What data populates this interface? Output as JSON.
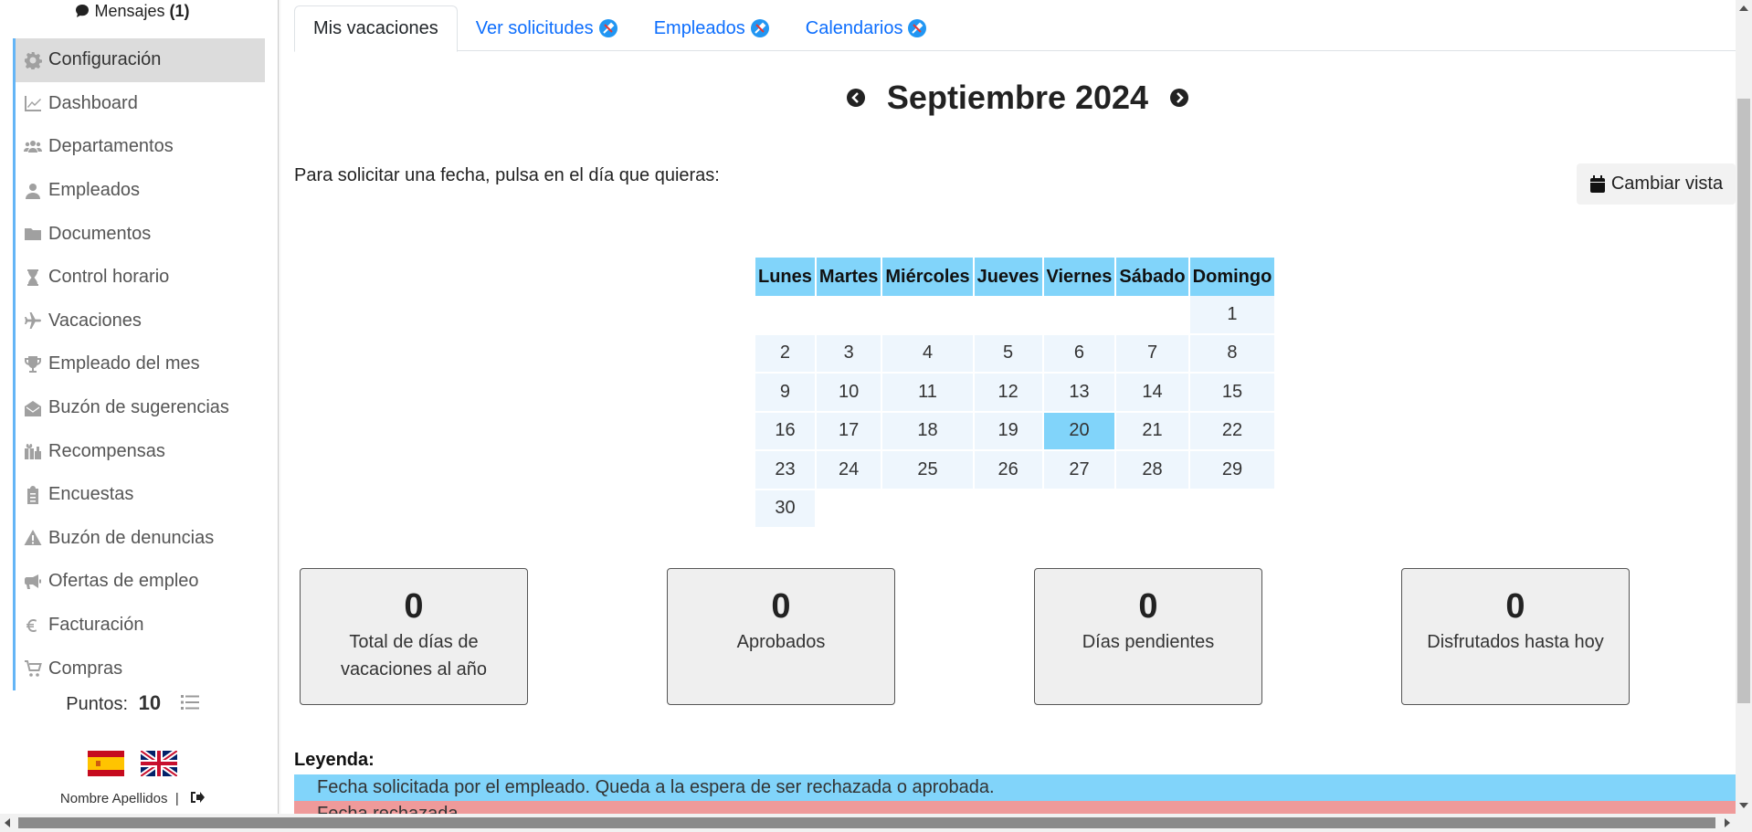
{
  "sidebar": {
    "messages_label": "Mensajes",
    "messages_count": "(1)",
    "items": [
      {
        "label": "Configuración",
        "icon": "gear-icon",
        "active": true
      },
      {
        "label": "Dashboard",
        "icon": "chart-line-icon"
      },
      {
        "label": "Departamentos",
        "icon": "users-icon"
      },
      {
        "label": "Empleados",
        "icon": "user-icon"
      },
      {
        "label": "Documentos",
        "icon": "folder-icon"
      },
      {
        "label": "Control horario",
        "icon": "hourglass-icon"
      },
      {
        "label": "Vacaciones",
        "icon": "plane-icon"
      },
      {
        "label": "Empleado del mes",
        "icon": "trophy-icon"
      },
      {
        "label": "Buzón de sugerencias",
        "icon": "envelope-open-icon"
      },
      {
        "label": "Recompensas",
        "icon": "gifts-icon"
      },
      {
        "label": "Encuestas",
        "icon": "clipboard-icon"
      },
      {
        "label": "Buzón de denuncias",
        "icon": "warning-icon"
      },
      {
        "label": "Ofertas de empleo",
        "icon": "megaphone-icon"
      },
      {
        "label": "Facturación",
        "icon": "euro-icon"
      },
      {
        "label": "Compras",
        "icon": "cart-icon"
      }
    ],
    "points_label": "Puntos:",
    "points_value": "10",
    "user_name": "Nombre Apellidos",
    "user_separator": "|"
  },
  "tabs": [
    {
      "label": "Mis vacaciones",
      "active": true
    },
    {
      "label": "Ver solicitudes",
      "tool_icon": true
    },
    {
      "label": "Empleados",
      "tool_icon": true
    },
    {
      "label": "Calendarios",
      "tool_icon": true
    }
  ],
  "calendar": {
    "month_title": "Septiembre 2024",
    "hint": "Para solicitar una fecha, pulsa en el día que quieras:",
    "change_view_label": "Cambiar vista",
    "weekdays": [
      "Lunes",
      "Martes",
      "Miércoles",
      "Jueves",
      "Viernes",
      "Sábado",
      "Domingo"
    ],
    "weeks": [
      [
        "",
        "",
        "",
        "",
        "",
        "",
        "1"
      ],
      [
        "2",
        "3",
        "4",
        "5",
        "6",
        "7",
        "8"
      ],
      [
        "9",
        "10",
        "11",
        "12",
        "13",
        "14",
        "15"
      ],
      [
        "16",
        "17",
        "18",
        "19",
        "20",
        "21",
        "22"
      ],
      [
        "23",
        "24",
        "25",
        "26",
        "27",
        "28",
        "29"
      ],
      [
        "30",
        "",
        "",
        "",
        "",
        "",
        ""
      ]
    ],
    "selected_day": "20"
  },
  "stats": [
    {
      "value": "0",
      "label": "Total de días de vacaciones al año"
    },
    {
      "value": "0",
      "label": "Aprobados"
    },
    {
      "value": "0",
      "label": "Días pendientes"
    },
    {
      "value": "0",
      "label": "Disfrutados hasta hoy"
    }
  ],
  "legend": {
    "title": "Leyenda:",
    "requested": "Fecha solicitada por el empleado. Queda a la espera de ser rechazada o aprobada.",
    "rejected": "Fecha rechazada"
  },
  "colors": {
    "accent": "#81d4fa",
    "rejected": "#ef9a9a",
    "link": "#0d6efd"
  }
}
